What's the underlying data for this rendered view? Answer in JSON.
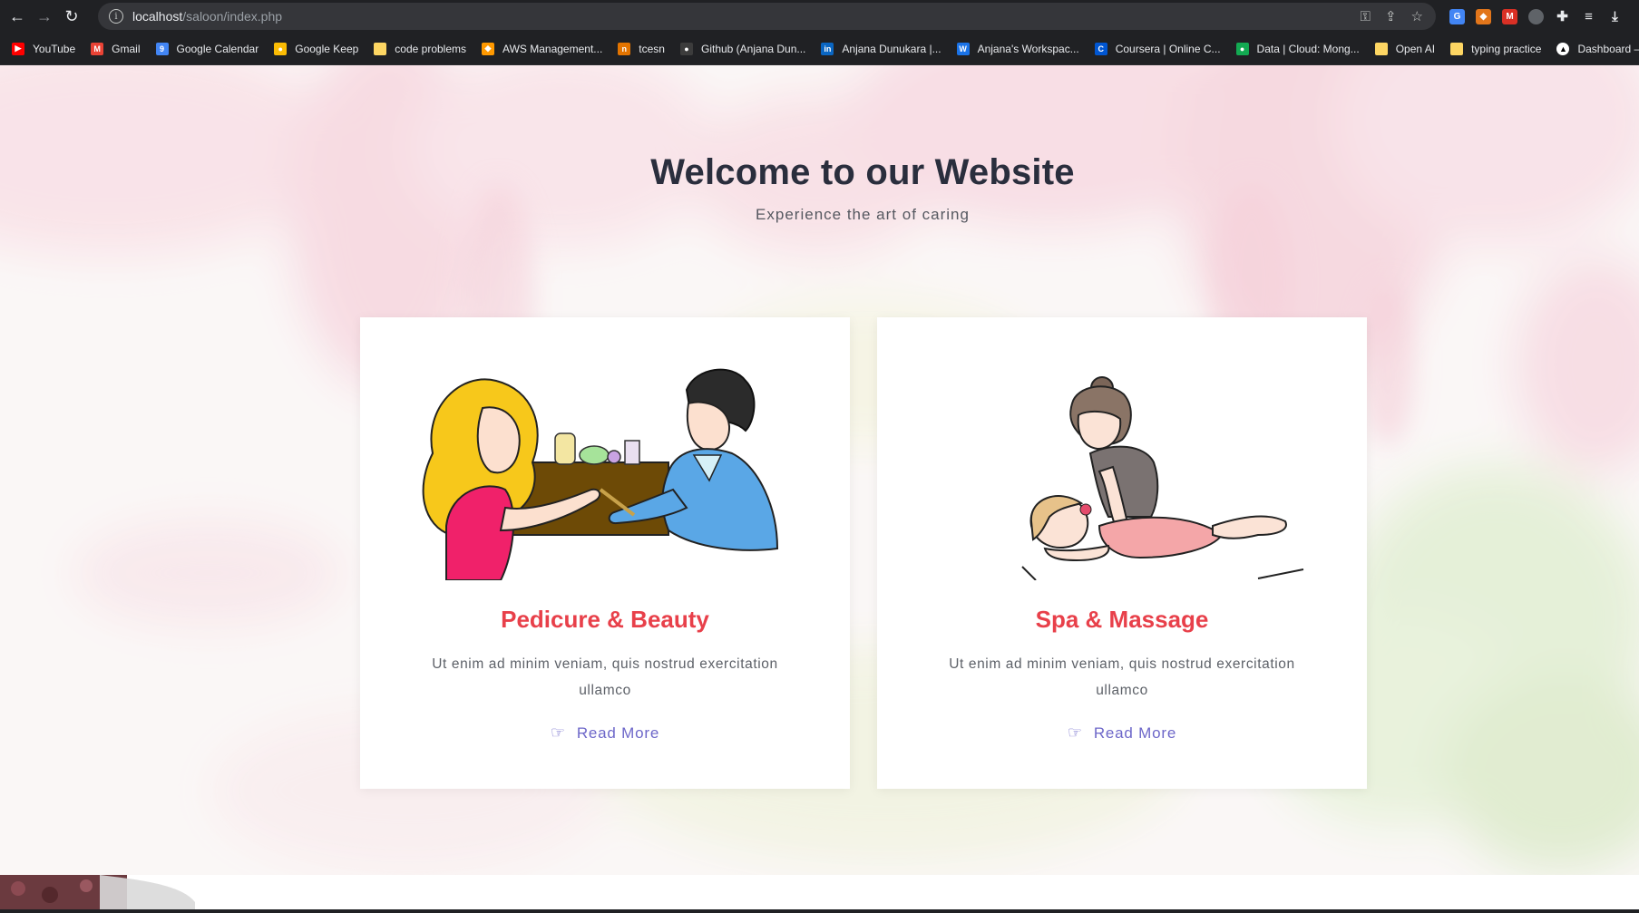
{
  "browser": {
    "url_host": "localhost",
    "url_path": "/saloon/index.php",
    "bookmarks": [
      {
        "label": "YouTube",
        "color": "#ff0000",
        "glyph": "▶"
      },
      {
        "label": "Gmail",
        "color": "#ea4335",
        "glyph": "M"
      },
      {
        "label": "Google Calendar",
        "color": "#4285f4",
        "glyph": "9"
      },
      {
        "label": "Google Keep",
        "color": "#fbbc04",
        "glyph": "●"
      },
      {
        "label": "code problems",
        "color": "#fdd663",
        "glyph": ""
      },
      {
        "label": "AWS Management...",
        "color": "#ff9900",
        "glyph": "◆"
      },
      {
        "label": "tcesn",
        "color": "#e37400",
        "glyph": "n"
      },
      {
        "label": "Github (Anjana Dun...",
        "color": "#3c3c3c",
        "glyph": "●"
      },
      {
        "label": "Anjana Dunukara |...",
        "color": "#0a66c2",
        "glyph": "in"
      },
      {
        "label": "Anjana's Workspac...",
        "color": "#1a73e8",
        "glyph": "W"
      },
      {
        "label": "Coursera | Online C...",
        "color": "#0056d2",
        "glyph": "C"
      },
      {
        "label": "Data | Cloud: Mong...",
        "color": "#13aa52",
        "glyph": "●"
      },
      {
        "label": "Open AI",
        "color": "#fdd663",
        "glyph": ""
      },
      {
        "label": "typing practice",
        "color": "#fdd663",
        "glyph": ""
      },
      {
        "label": "Dashboard – Ve",
        "color": "#ffffff",
        "glyph": "▲"
      }
    ]
  },
  "hero": {
    "title": "Welcome to our Website",
    "subtitle": "Experience the art of caring"
  },
  "cards": [
    {
      "title": "Pedicure & Beauty",
      "text": "Ut enim ad minim veniam, quis nostrud exercitation ullamco",
      "link": "Read More",
      "image": "manicure-illustration"
    },
    {
      "title": "Spa & Massage",
      "text": "Ut enim ad minim veniam, quis nostrud exercitation ullamco",
      "link": "Read More",
      "image": "massage-illustration"
    }
  ],
  "colors": {
    "accent": "#e8404a",
    "link": "#6d67c9",
    "title": "#2a2e3d"
  }
}
